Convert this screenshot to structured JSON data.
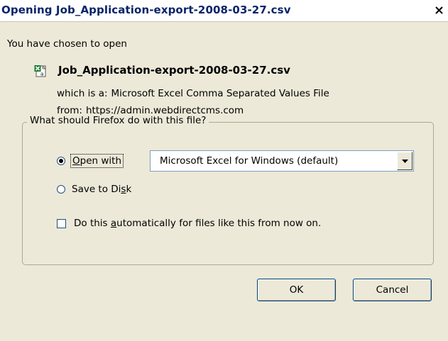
{
  "window": {
    "title": "Opening Job_Application-export-2008-03-27.csv",
    "close_label": "×"
  },
  "dialog": {
    "prompt": "You have chosen to open",
    "file_name": "Job_Application-export-2008-03-27.csv",
    "file_icon": "excel-csv-icon",
    "type_label": "which is a:",
    "type_value": "Microsoft Excel Comma Separated Values File",
    "from_label": "from:",
    "from_value": "https://admin.webdirectcms.com"
  },
  "group": {
    "legend": "What should Firefox do with this file?",
    "open_with": {
      "pre": "",
      "accel": "O",
      "post": "pen with",
      "selected": true
    },
    "app_select": {
      "value": "Microsoft Excel for Windows (default)"
    },
    "save_to_disk": {
      "pre": "Save to Di",
      "accel": "s",
      "post": "k",
      "selected": false
    },
    "auto": {
      "pre": "Do this ",
      "accel": "a",
      "post": "utomatically for files like this from now on.",
      "checked": false
    }
  },
  "buttons": {
    "ok": "OK",
    "cancel": "Cancel"
  },
  "colors": {
    "dialog_bg": "#ece9d8",
    "title_text": "#0a246a",
    "excel_green": "#1e7b34"
  }
}
